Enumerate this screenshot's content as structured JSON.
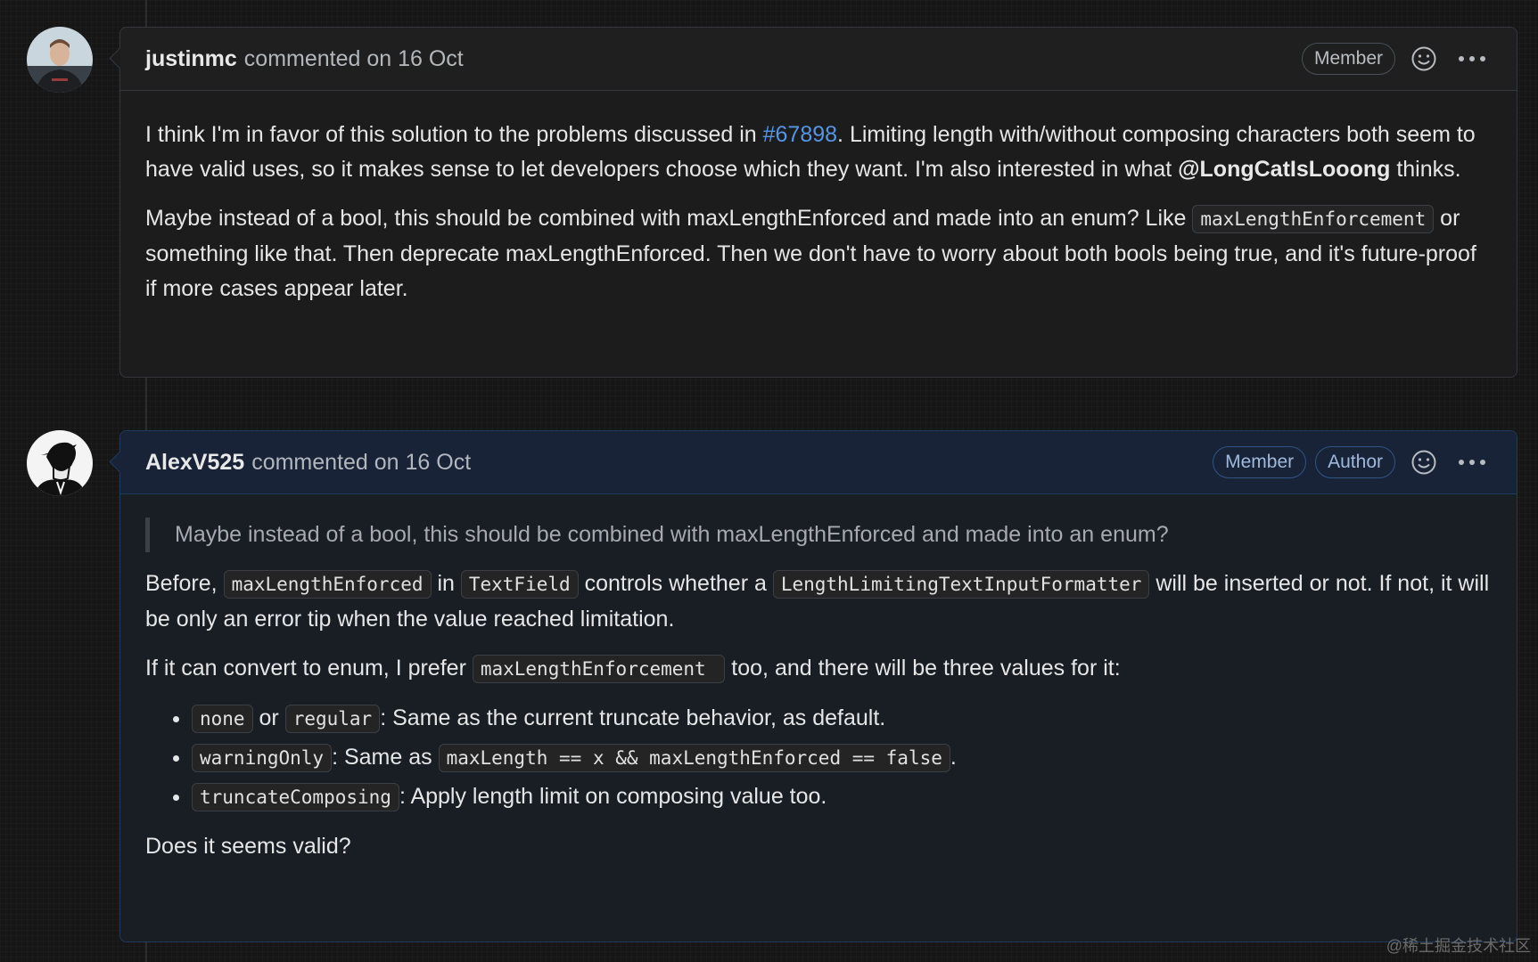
{
  "comments": [
    {
      "username": "justinmc",
      "meta": "commented on 16 Oct",
      "badges": [
        "Member"
      ],
      "avatar_icon": "user-photo-avatar",
      "para1": {
        "pre": "I think I'm in favor of this solution to the problems discussed in ",
        "link": "#67898",
        "mid": ". Limiting length with/without composing characters both seem to have valid uses, so it makes sense to let developers choose which they want. I'm also interested in what ",
        "mention": "@LongCatIsLooong",
        "post": " thinks."
      },
      "para2": {
        "pre": "Maybe instead of a bool, this should be combined with maxLengthEnforced and made into an enum? Like ",
        "code": "maxLengthEnforcement",
        "post": " or something like that. Then deprecate maxLengthEnforced. Then we don't have to worry about both bools being true, and it's future-proof if more cases appear later."
      }
    },
    {
      "username": "AlexV525",
      "meta": "commented on 16 Oct",
      "badges": [
        "Member",
        "Author"
      ],
      "avatar_icon": "illustrated-avatar",
      "quote": "Maybe instead of a bool, this should be combined with maxLengthEnforced and made into an enum?",
      "para1": {
        "t1": "Before, ",
        "c1": "maxLengthEnforced",
        "t2": " in ",
        "c2": "TextField",
        "t3": " controls whether a ",
        "c3": "LengthLimitingTextInputFormatter",
        "t4": " will be inserted or not. If not, it will be only an error tip when the value reached limitation."
      },
      "para2": {
        "pre": "If it can convert to enum, I prefer ",
        "code": "maxLengthEnforcement ",
        "post": " too, and there will be three values for it:"
      },
      "list": [
        {
          "c1": "none",
          "t1": " or ",
          "c2": "regular",
          "t2": ": Same as the current truncate behavior, as default."
        },
        {
          "c1": "warningOnly",
          "t1": ": Same as ",
          "c2": "maxLength == x && maxLengthEnforced == false",
          "t2": "."
        },
        {
          "c1": "truncateComposing",
          "t1": ": Apply length limit on composing value too."
        }
      ],
      "closing": "Does it seems valid?"
    }
  ],
  "icons": {
    "reaction": "smiley-icon",
    "menu": "ellipsis-icon"
  },
  "watermark": "@稀土掘金技术社区"
}
